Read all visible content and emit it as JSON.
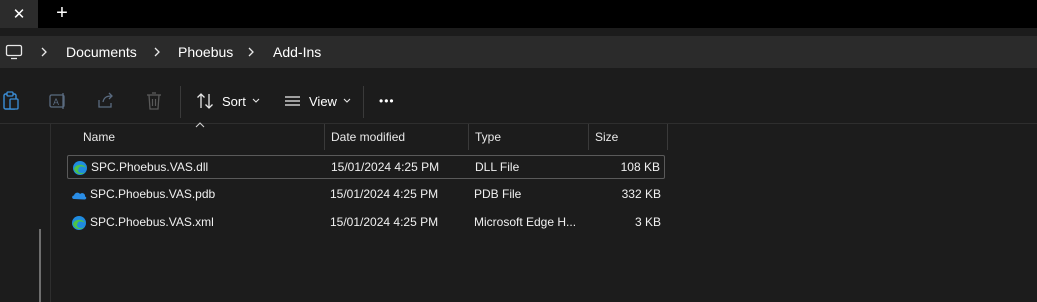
{
  "tabs": {
    "close_label": "✕",
    "new_label": "+"
  },
  "breadcrumb": {
    "items": [
      "Documents",
      "Phoebus",
      "Add-Ins"
    ]
  },
  "toolbar": {
    "sort_label": "Sort",
    "view_label": "View",
    "more_label": "•••"
  },
  "columns": {
    "name": "Name",
    "date": "Date modified",
    "type": "Type",
    "size": "Size"
  },
  "files": [
    {
      "name": "SPC.Phoebus.VAS.dll",
      "date": "15/01/2024 4:25 PM",
      "type": "DLL File",
      "size": "108 KB",
      "icon": "edge-icon"
    },
    {
      "name": "SPC.Phoebus.VAS.pdb",
      "date": "15/01/2024 4:25 PM",
      "type": "PDB File",
      "size": "332 KB",
      "icon": "onedrive-cloud-icon"
    },
    {
      "name": "SPC.Phoebus.VAS.xml",
      "date": "15/01/2024 4:25 PM",
      "type": "Microsoft Edge H...",
      "size": "3 KB",
      "icon": "edge-icon"
    }
  ],
  "colors": {
    "background": "#1c1c1c",
    "tabbar": "#000000",
    "addressbar": "#2b2b2b",
    "edge_blue": "#1f8be0",
    "edge_green": "#4cc24a",
    "onedrive_blue": "#2a8de6"
  }
}
